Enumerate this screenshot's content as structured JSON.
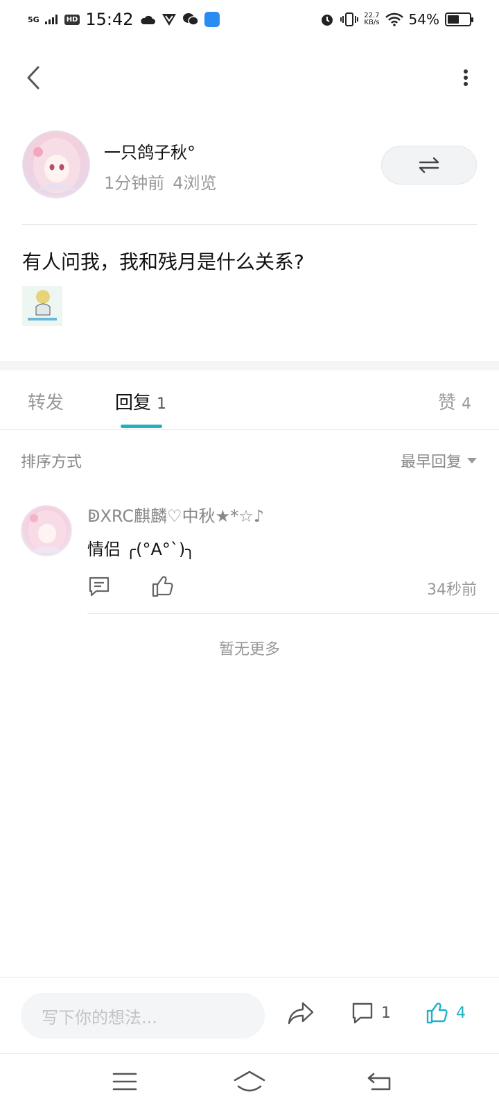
{
  "status_bar": {
    "network": "5G",
    "hd": "HD",
    "time": "15:42",
    "speed_value": "22.7",
    "speed_unit": "KB/s",
    "battery_percent": "54%",
    "battery_level": 0.54
  },
  "post": {
    "author_name": "一只鸽子秋°",
    "time_ago": "1分钟前",
    "views": "4浏览",
    "text": "有人问我，我和残月是什么关系?"
  },
  "tabs": {
    "repost_label": "转发",
    "reply_label": "回复",
    "reply_count": "1",
    "like_label": "赞",
    "like_count": "4"
  },
  "sort": {
    "label": "排序方式",
    "selected": "最早回复"
  },
  "comment": {
    "author": "ↁXRC麒麟♡中秋★*☆♪",
    "text": "情侣 ╭(°A°`)╮",
    "time": "34秒前"
  },
  "list_end": "暂无更多",
  "bottom_bar": {
    "input_placeholder": "写下你的想法...",
    "comment_count": "1",
    "like_count": "4"
  },
  "colors": {
    "accent": "#21b1c4",
    "muted_text": "#999999",
    "divider": "#e6e6e6"
  },
  "icons": [
    "back-icon",
    "more-icon",
    "switch-icon",
    "reply-icon",
    "like-icon",
    "share-icon",
    "comment-icon",
    "menu-icon",
    "home-icon",
    "nav-back-icon"
  ]
}
